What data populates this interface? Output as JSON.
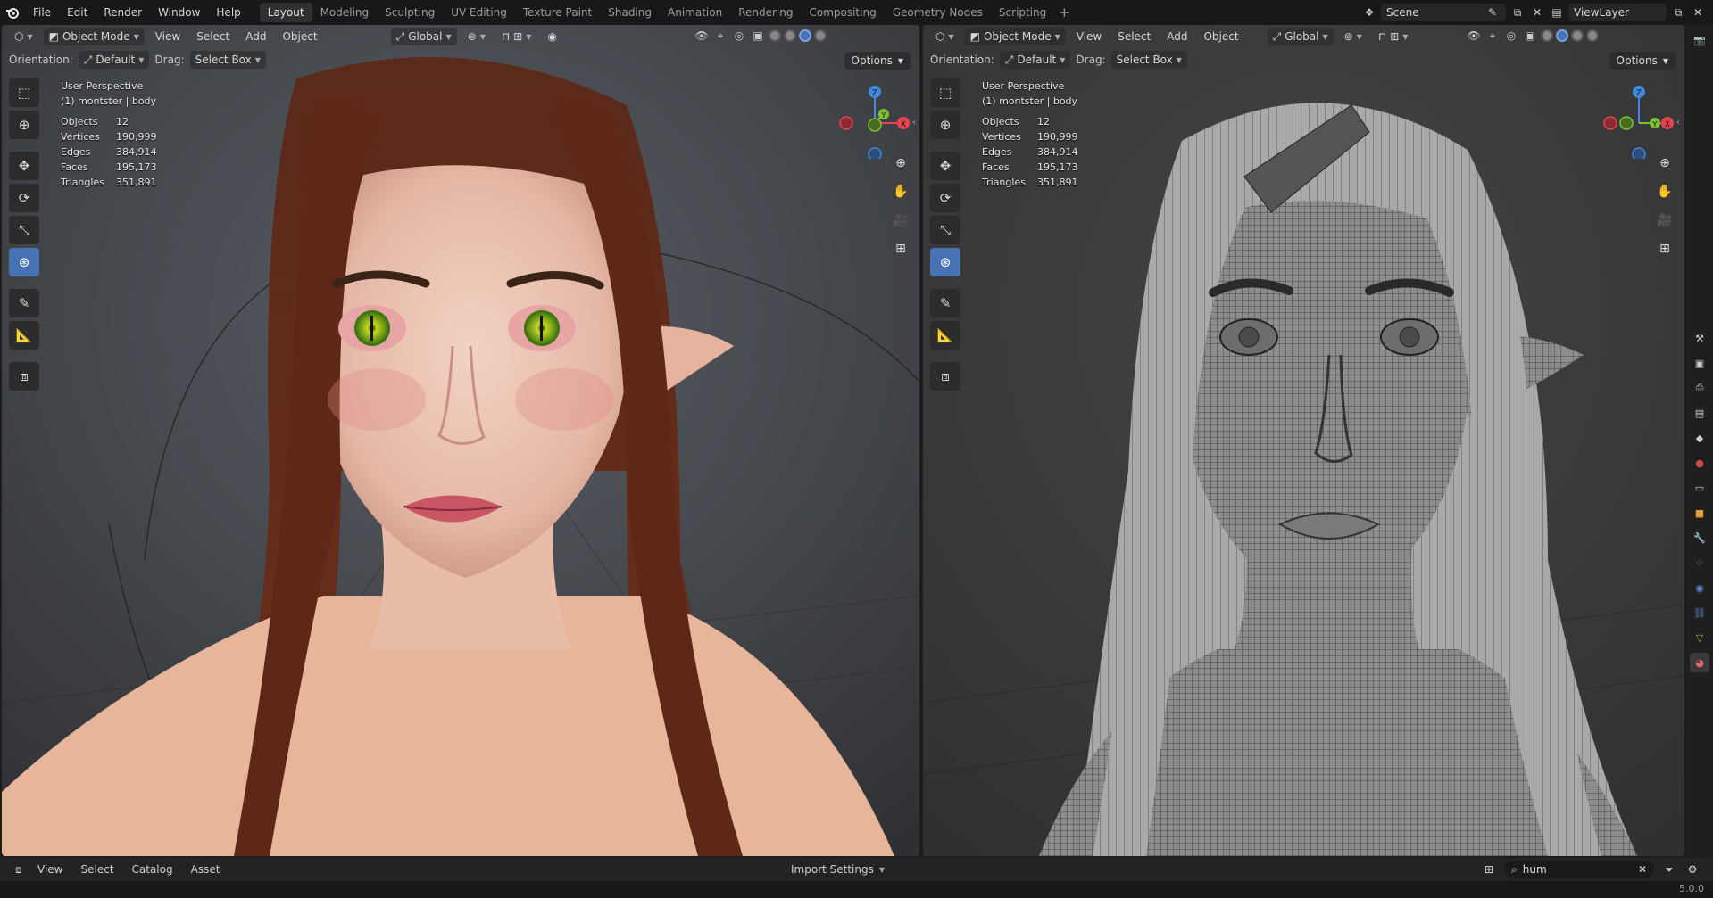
{
  "menu": {
    "items": [
      "File",
      "Edit",
      "Render",
      "Window",
      "Help"
    ]
  },
  "workspaces": {
    "tabs": [
      "Layout",
      "Modeling",
      "Sculpting",
      "UV Editing",
      "Texture Paint",
      "Shading",
      "Animation",
      "Rendering",
      "Compositing",
      "Geometry Nodes",
      "Scripting"
    ],
    "active": "Layout"
  },
  "topright": {
    "scene": "Scene",
    "view_layer": "ViewLayer"
  },
  "viewport_left": {
    "mode": "Object Mode",
    "menus": [
      "View",
      "Select",
      "Add",
      "Object"
    ],
    "transform": "Global",
    "orientation_label": "Orientation:",
    "orientation_value": "Default",
    "drag_label": "Drag:",
    "drag_value": "Select Box",
    "options": "Options",
    "perspective": "User Perspective",
    "active_object": "(1) montster | body",
    "stats": [
      {
        "label": "Objects",
        "value": "12"
      },
      {
        "label": "Vertices",
        "value": "190,999"
      },
      {
        "label": "Edges",
        "value": "384,914"
      },
      {
        "label": "Faces",
        "value": "195,173"
      },
      {
        "label": "Triangles",
        "value": "351,891"
      }
    ]
  },
  "viewport_right": {
    "mode": "Object Mode",
    "menus": [
      "View",
      "Select",
      "Add",
      "Object"
    ],
    "transform": "Global",
    "orientation_label": "Orientation:",
    "orientation_value": "Default",
    "drag_label": "Drag:",
    "drag_value": "Select Box",
    "options": "Options",
    "perspective": "User Perspective",
    "active_object": "(1) montster | body",
    "stats": [
      {
        "label": "Objects",
        "value": "12"
      },
      {
        "label": "Vertices",
        "value": "190,999"
      },
      {
        "label": "Edges",
        "value": "384,914"
      },
      {
        "label": "Faces",
        "value": "195,173"
      },
      {
        "label": "Triangles",
        "value": "351,891"
      }
    ]
  },
  "gizmo": {
    "z": "Z",
    "y": "Y",
    "x": "X"
  },
  "asset_browser": {
    "menus": [
      "View",
      "Select",
      "Catalog",
      "Asset"
    ],
    "import_settings": "Import Settings",
    "search_value": "hum"
  },
  "status": {
    "version": "5.0.0"
  },
  "colors": {
    "accent": "#4772b3",
    "axis_x": "#e8434e",
    "axis_y": "#7dc234",
    "axis_z": "#3f8ae0"
  }
}
